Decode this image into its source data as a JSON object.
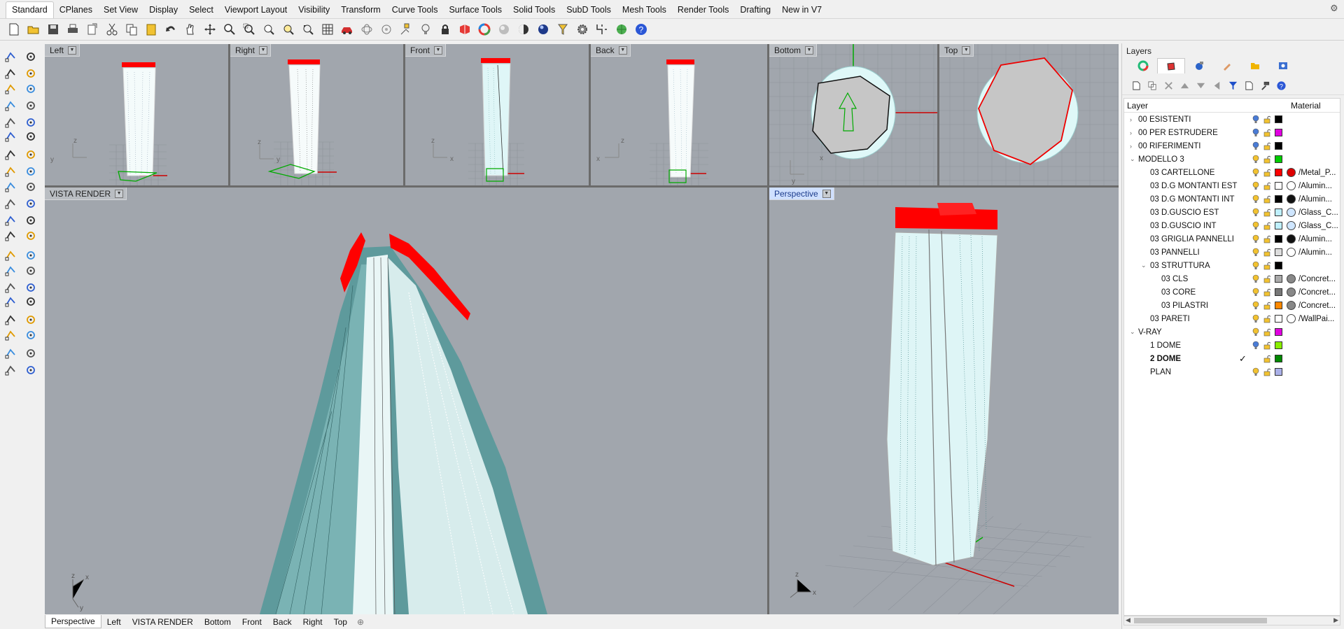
{
  "tabs": [
    "Standard",
    "CPlanes",
    "Set View",
    "Display",
    "Select",
    "Viewport Layout",
    "Visibility",
    "Transform",
    "Curve Tools",
    "Surface Tools",
    "Solid Tools",
    "SubD Tools",
    "Mesh Tools",
    "Render Tools",
    "Drafting",
    "New in V7"
  ],
  "active_tab": "Standard",
  "toolbar_icons": [
    "new-icon",
    "open-icon",
    "save-icon",
    "print-icon",
    "import-icon",
    "cut-icon",
    "copy-icon",
    "paste-icon",
    "undo-icon",
    "pan-icon",
    "rotate-view-icon",
    "zoom-icon",
    "zoom-window-icon",
    "zoom-extents-icon",
    "zoom-selected-icon",
    "rotate-icon",
    "grid-icon",
    "car-icon",
    "wireframe-icon",
    "ghosted-icon",
    "snap-icon",
    "light-icon",
    "lock-icon",
    "materials-icon",
    "color-wheel-icon",
    "shaded-sphere-icon",
    "rendered-sphere-icon",
    "glossy-sphere-icon",
    "select-filter-icon",
    "gear-settings-icon",
    "trim-icon",
    "globe-icon",
    "help-icon"
  ],
  "viewports": {
    "left": {
      "label": "Left"
    },
    "right": {
      "label": "Right"
    },
    "front": {
      "label": "Front"
    },
    "back": {
      "label": "Back"
    },
    "bottom": {
      "label": "Bottom"
    },
    "top": {
      "label": "Top"
    },
    "render": {
      "label": "VISTA RENDER"
    },
    "perspective": {
      "label": "Perspective"
    }
  },
  "view_tabs": [
    "Perspective",
    "Left",
    "VISTA RENDER",
    "Bottom",
    "Front",
    "Back",
    "Right",
    "Top"
  ],
  "active_view_tab": "Perspective",
  "layers_panel": {
    "title": "Layers",
    "col_layer": "Layer",
    "col_material": "Material",
    "rows": [
      {
        "name": "00 ESISTENTI",
        "indent": 0,
        "expander": ">",
        "bulb": "blue",
        "color": "#000000",
        "material": "",
        "mat_color": ""
      },
      {
        "name": "00 PER ESTRUDERE",
        "indent": 0,
        "expander": ">",
        "bulb": "blue",
        "color": "#e000e0",
        "material": "",
        "mat_color": ""
      },
      {
        "name": "00 RIFERIMENTI",
        "indent": 0,
        "expander": ">",
        "bulb": "blue",
        "color": "#000000",
        "material": "",
        "mat_color": ""
      },
      {
        "name": "MODELLO 3",
        "indent": 0,
        "expander": "v",
        "bulb": "yellow",
        "color": "#00cc00",
        "material": "",
        "mat_color": ""
      },
      {
        "name": "03 CARTELLONE",
        "indent": 1,
        "expander": "",
        "bulb": "yellow",
        "color": "#ff0000",
        "material": "/Metal_P...",
        "mat_color": "#dd0000"
      },
      {
        "name": "03 D.G MONTANTI EST",
        "indent": 1,
        "expander": "",
        "bulb": "yellow",
        "color": "#ffffff",
        "material": "/Alumin...",
        "mat_color": "#ffffff"
      },
      {
        "name": "03 D.G MONTANTI INT",
        "indent": 1,
        "expander": "",
        "bulb": "yellow",
        "color": "#000000",
        "material": "/Alumin...",
        "mat_color": "#111111"
      },
      {
        "name": "03 D.GUSCIO EST",
        "indent": 1,
        "expander": "",
        "bulb": "yellow",
        "color": "#bff0ff",
        "material": "/Glass_C...",
        "mat_color": "#cfe6ff"
      },
      {
        "name": "03 D.GUSCIO INT",
        "indent": 1,
        "expander": "",
        "bulb": "yellow",
        "color": "#bff0ff",
        "material": "/Glass_C...",
        "mat_color": "#cfe6ff"
      },
      {
        "name": "03 GRIGLIA PANNELLI",
        "indent": 1,
        "expander": "",
        "bulb": "yellow",
        "color": "#000000",
        "material": "/Alumin...",
        "mat_color": "#111111"
      },
      {
        "name": "03 PANNELLI",
        "indent": 1,
        "expander": "",
        "bulb": "yellow",
        "color": "#dddddd",
        "material": "/Alumin...",
        "mat_color": "#ffffff"
      },
      {
        "name": "03 STRUTTURA",
        "indent": 1,
        "expander": "v",
        "bulb": "yellow",
        "color": "#000000",
        "material": "",
        "mat_color": ""
      },
      {
        "name": "03 CLS",
        "indent": 2,
        "expander": "",
        "bulb": "yellow",
        "color": "#aaaaaa",
        "material": "/Concret...",
        "mat_color": "#888888"
      },
      {
        "name": "03 CORE",
        "indent": 2,
        "expander": "",
        "bulb": "yellow",
        "color": "#777777",
        "material": "/Concret...",
        "mat_color": "#888888"
      },
      {
        "name": "03 PILASTRI",
        "indent": 2,
        "expander": "",
        "bulb": "yellow",
        "color": "#ff8800",
        "material": "/Concret...",
        "mat_color": "#888888"
      },
      {
        "name": "03 PARETI",
        "indent": 1,
        "expander": "",
        "bulb": "yellow",
        "color": "#ffffff",
        "material": "/WallPai...",
        "mat_color": "#ffffff"
      },
      {
        "name": "V-RAY",
        "indent": 0,
        "expander": "v",
        "bulb": "yellow",
        "color": "#e000e0",
        "material": "",
        "mat_color": ""
      },
      {
        "name": "1 DOME",
        "indent": 1,
        "expander": "",
        "bulb": "blue",
        "color": "#88ee00",
        "material": "",
        "mat_color": ""
      },
      {
        "name": "2 DOME",
        "indent": 1,
        "expander": "",
        "bulb": "none",
        "current": true,
        "color": "#008800",
        "material": "",
        "mat_color": ""
      },
      {
        "name": "PLAN",
        "indent": 1,
        "expander": "",
        "bulb": "yellow",
        "color": "#aab0e8",
        "material": "",
        "mat_color": ""
      }
    ]
  }
}
